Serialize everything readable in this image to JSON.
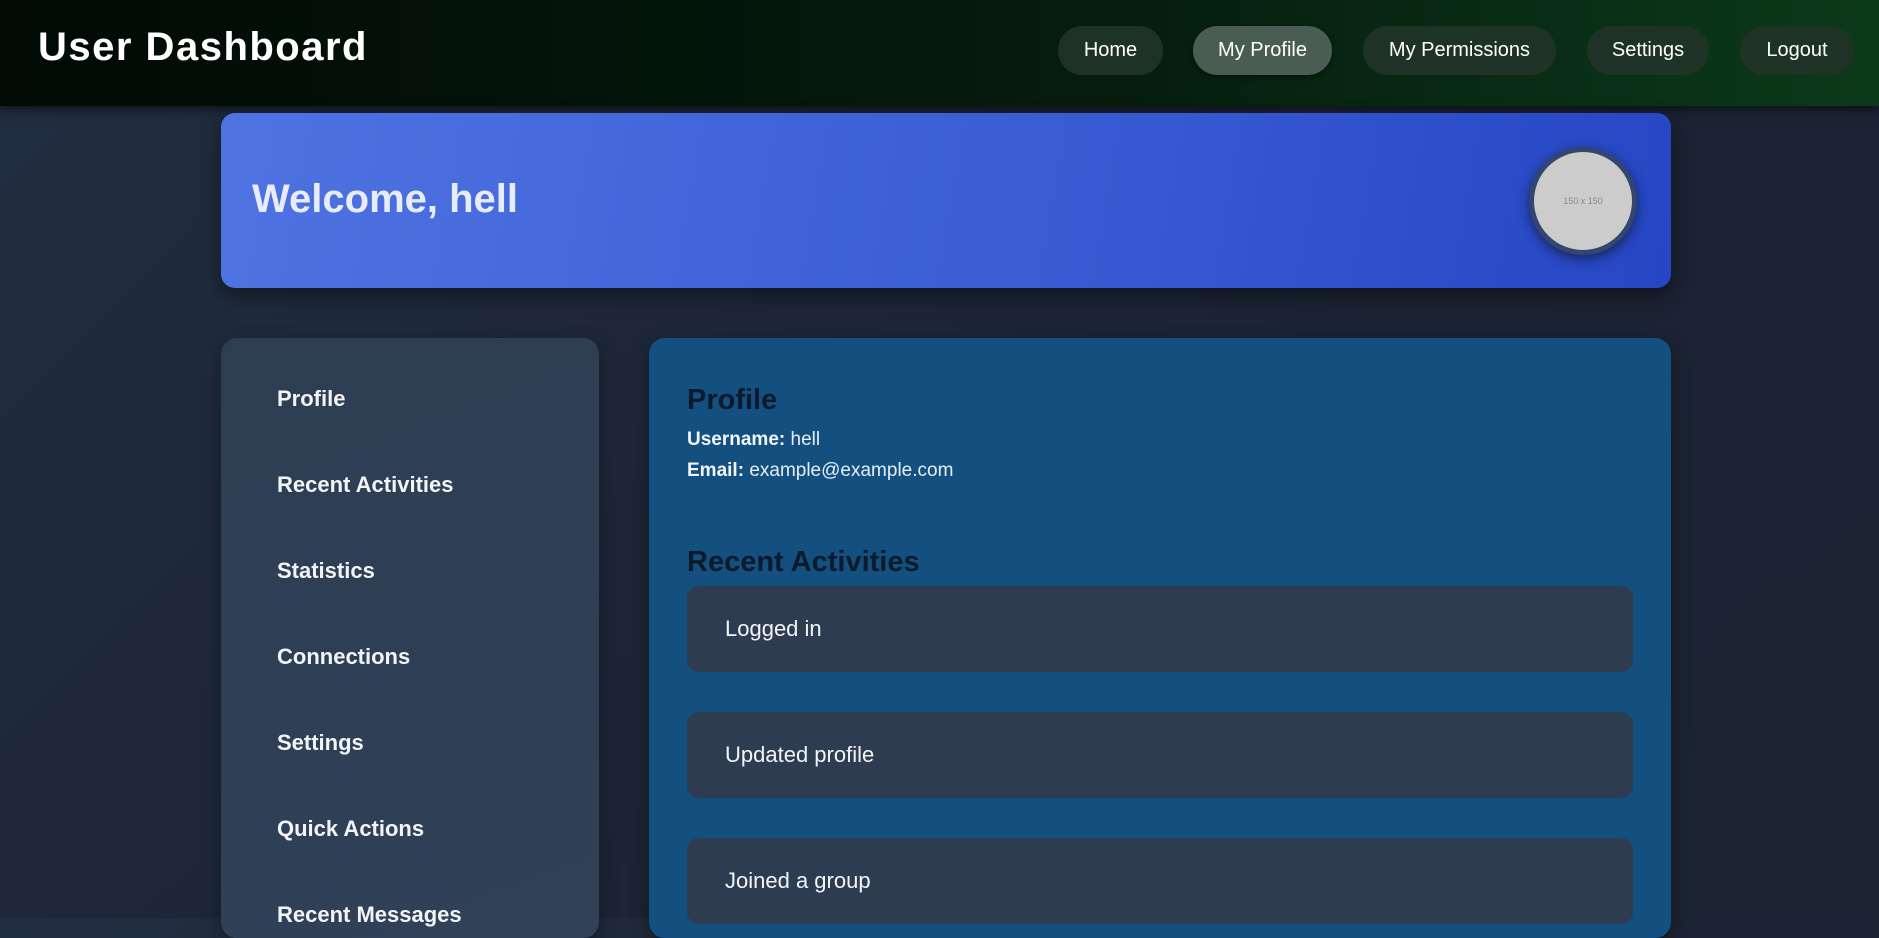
{
  "header": {
    "title": "User Dashboard",
    "nav": [
      {
        "label": "Home",
        "active": false
      },
      {
        "label": "My Profile",
        "active": true
      },
      {
        "label": "My Permissions",
        "active": false
      },
      {
        "label": "Settings",
        "active": false
      },
      {
        "label": "Logout",
        "active": false
      }
    ]
  },
  "hero": {
    "welcome": "Welcome, hell",
    "avatar_text": "150 x 150"
  },
  "sidebar": {
    "items": [
      {
        "label": "Profile"
      },
      {
        "label": "Recent Activities"
      },
      {
        "label": "Statistics"
      },
      {
        "label": "Connections"
      },
      {
        "label": "Settings"
      },
      {
        "label": "Quick Actions"
      },
      {
        "label": "Recent Messages"
      }
    ]
  },
  "main": {
    "profile": {
      "title": "Profile",
      "username_label": "Username:",
      "username": "hell",
      "email_label": "Email:",
      "email": "example@example.com"
    },
    "activities": {
      "title": "Recent Activities",
      "items": [
        {
          "text": "Logged in"
        },
        {
          "text": "Updated profile"
        },
        {
          "text": "Joined a group"
        }
      ]
    }
  },
  "colors": {
    "header_bg_start": "#010a05",
    "header_bg_end": "#0b3a1a",
    "hero_start": "#4f73e2",
    "hero_end": "#2646c4",
    "sidebar_bg": "#2d3d52",
    "main_bg": "#135080",
    "card_bg": "#2d3c50"
  }
}
